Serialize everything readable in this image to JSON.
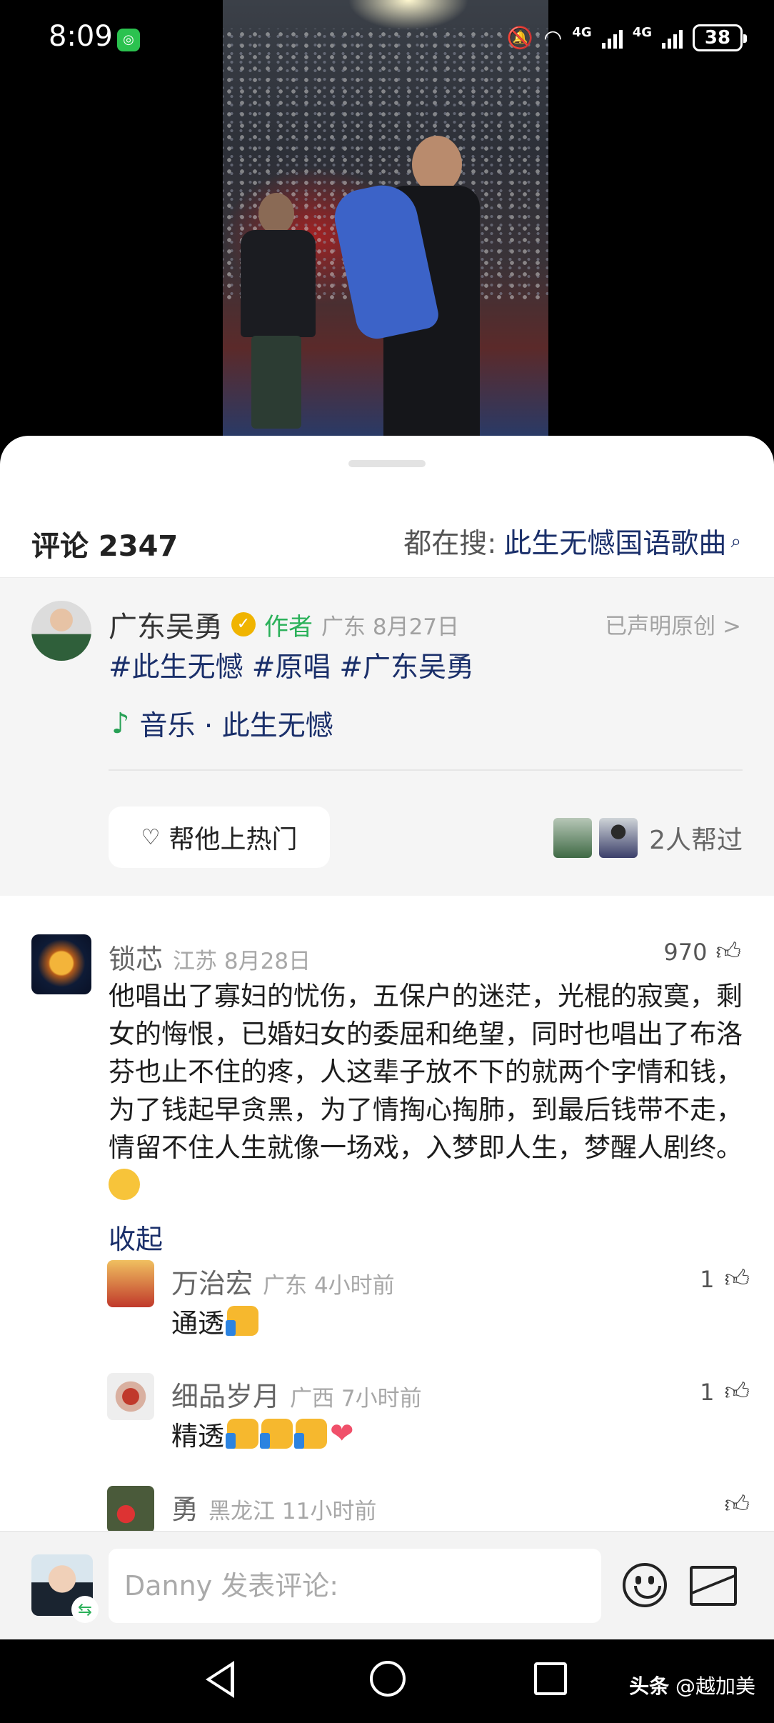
{
  "status_bar": {
    "time": "8:09",
    "net1": "4G",
    "net2": "4G",
    "battery": "38"
  },
  "header": {
    "comments_label": "评论 2347",
    "search_prefix": "都在搜:",
    "search_keyword": "此生无憾国语歌曲"
  },
  "author_post": {
    "name": "广东吴勇",
    "tag": "作者",
    "location_date": "广东 8月27日",
    "original_label": "已声明原创 >",
    "hashtags": [
      "#此生无憾",
      "#原唱",
      "#广东吴勇"
    ],
    "music_label": "音乐 · 此生无憾",
    "boost_button": "帮他上热门",
    "helpers_text": "2人帮过"
  },
  "comment": {
    "name": "锁芯",
    "meta": "江苏 8月28日",
    "likes": "970",
    "text": "他唱出了寡妇的忧伤，五保户的迷茫，光棍的寂寞，剩女的悔恨，已婚妇女的委屈和绝望，同时也唱出了布洛芬也止不住的疼，人这辈子放不下的就两个字情和钱，为了钱起早贪黑，为了情掏心掏肺，到最后钱带不走，情留不住人生就像一场戏，入梦即人生，梦醒人剧终。",
    "collapse": "收起"
  },
  "replies": [
    {
      "name": "万治宏",
      "meta": "广东 4小时前",
      "likes": "1",
      "text": "通透"
    },
    {
      "name": "细品岁月",
      "meta": "广西 7小时前",
      "likes": "1",
      "text": "精透"
    },
    {
      "name": "勇",
      "meta": "黑龙江 11小时前",
      "likes": "",
      "text": ""
    }
  ],
  "input": {
    "placeholder": "Danny 发表评论:"
  },
  "watermark": {
    "brand": "头条",
    "handle": "@越加美"
  }
}
